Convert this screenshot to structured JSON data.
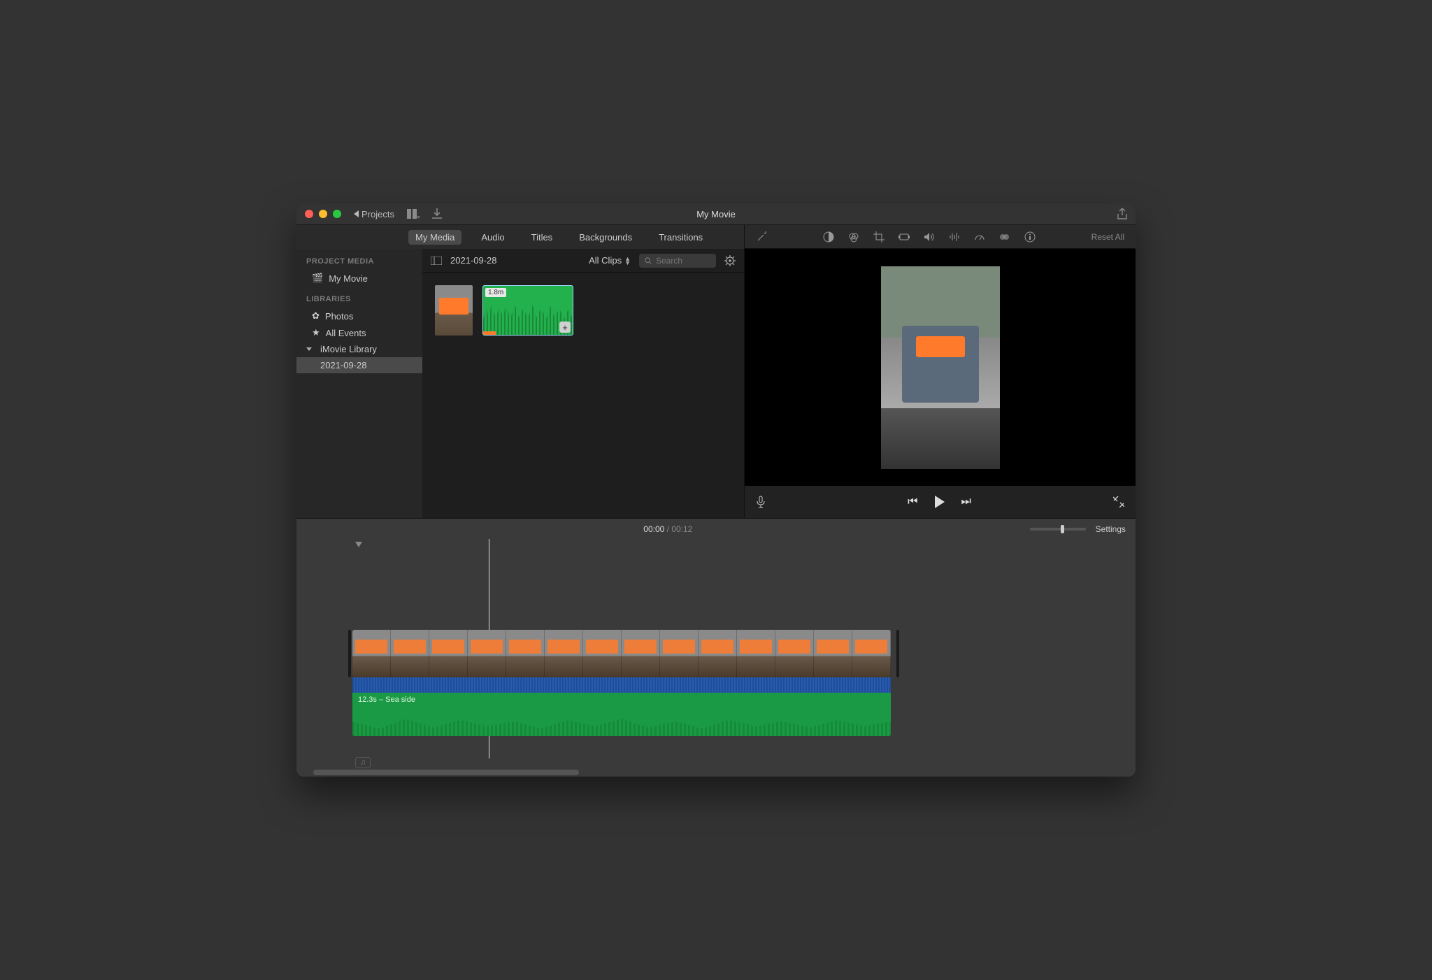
{
  "titlebar": {
    "back_label": "Projects",
    "title": "My Movie"
  },
  "media_tabs": [
    "My Media",
    "Audio",
    "Titles",
    "Backgrounds",
    "Transitions"
  ],
  "media_tab_active": 0,
  "sidebar": {
    "project_media_header": "PROJECT MEDIA",
    "project_item": "My Movie",
    "libraries_header": "LIBRARIES",
    "photos": "Photos",
    "all_events": "All Events",
    "imovie_library": "iMovie Library",
    "selected_event": "2021-09-28"
  },
  "browser": {
    "event_name": "2021-09-28",
    "filter": "All Clips",
    "search_placeholder": "Search",
    "audio_clip_duration": "1.8m"
  },
  "adjust": {
    "reset": "Reset All"
  },
  "timeline": {
    "current": "00:00",
    "sep": " / ",
    "duration": "00:12",
    "settings": "Settings",
    "audio_track_label": "12.3s – Sea side"
  }
}
